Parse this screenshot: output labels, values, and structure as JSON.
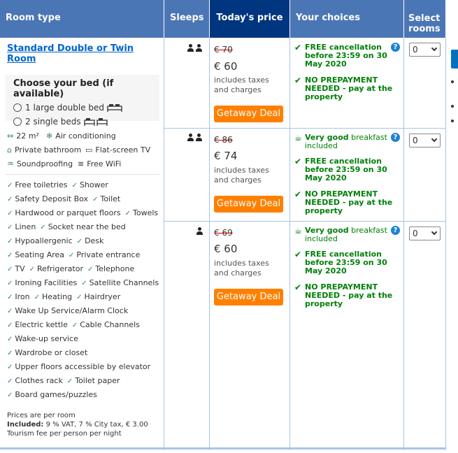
{
  "headers": {
    "room_type": "Room type",
    "sleeps": "Sleeps",
    "todays_price": "Today's price",
    "your_choices": "Your choices",
    "select_rooms_line1": "Select",
    "select_rooms_line2": "rooms"
  },
  "room": {
    "name_line1": "Standard Double or Twin",
    "name_line2": "Room",
    "bed_title": "Choose your bed (if available)",
    "bed_option_1": "1 large double bed",
    "bed_option_2": "2 single beds",
    "facilities": {
      "size": "22 m²",
      "air": "Air conditioning",
      "bath": "Private bathroom",
      "tv": "Flat-screen TV",
      "sound": "Soundproofing",
      "wifi": "Free WiFi"
    },
    "amenities": [
      [
        "Free toiletries",
        "Shower"
      ],
      [
        "Safety Deposit Box",
        "Toilet"
      ],
      [
        "Hardwood or parquet floors",
        "Towels"
      ],
      [
        "Linen",
        "Socket near the bed"
      ],
      [
        "Hypoallergenic",
        "Desk"
      ],
      [
        "Seating Area",
        "Private entrance"
      ],
      [
        "TV",
        "Refrigerator",
        "Telephone"
      ],
      [
        "Ironing Facilities",
        "Satellite Channels"
      ],
      [
        "Iron",
        "Heating",
        "Hairdryer"
      ],
      [
        "Wake Up Service/Alarm Clock"
      ],
      [
        "Electric kettle",
        "Cable Channels"
      ],
      [
        "Wake-up service"
      ],
      [
        "Wardrobe or closet"
      ],
      [
        "Upper floors accessible by elevator"
      ],
      [
        "Clothes rack",
        "Toilet paper"
      ],
      [
        "Board games/puzzles"
      ]
    ],
    "notes_line1": "Prices are per room",
    "notes_included_label": "Included:",
    "notes_included_line1": " 9 % VAT, 7 % City tax, € 3.00",
    "notes_included_line2": "Tourism fee per person per night"
  },
  "offers": [
    {
      "sleeps": 2,
      "old_price": "€ 70",
      "price": "€ 60",
      "taxes": "includes taxes and charges",
      "deal": "Getaway Deal",
      "choices": [
        {
          "bold": "FREE cancellation before 23:59 on 30 May 2020",
          "rest": ""
        },
        {
          "bold": "NO PREPAYMENT NEEDED",
          "rest": " - pay at the property"
        }
      ],
      "select_value": "0"
    },
    {
      "sleeps": 2,
      "old_price": "€ 86",
      "price": "€ 74",
      "taxes": "includes taxes and charges",
      "deal": "Getaway Deal",
      "breakfast_bold": "Very good",
      "breakfast_rest": " breakfast included",
      "choices": [
        {
          "bold": "FREE cancellation before 23:59 on 30 May 2020",
          "rest": ""
        },
        {
          "bold": "NO PREPAYMENT NEEDED",
          "rest": " - pay at the property"
        }
      ],
      "select_value": "0"
    },
    {
      "sleeps": 1,
      "old_price": "€ 69",
      "price": "€ 60",
      "taxes": "includes taxes and charges",
      "deal": "Getaway Deal",
      "breakfast_bold": "Very good",
      "breakfast_rest": " breakfast included",
      "choices": [
        {
          "bold": "FREE cancellation before 23:59 on 30 May 2020",
          "rest": ""
        },
        {
          "bold": "NO PREPAYMENT NEEDED",
          "rest": " - pay at the property"
        }
      ],
      "select_value": "0"
    }
  ],
  "colors": {
    "header": "#4b76b5",
    "header_dark": "#003580",
    "deal": "#ff8000",
    "green": "#008009",
    "link": "#0066cc"
  }
}
